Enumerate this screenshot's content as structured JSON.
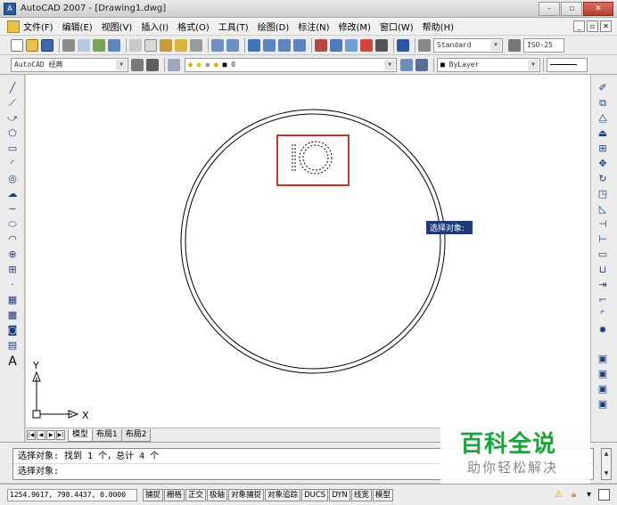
{
  "window": {
    "title": "AutoCAD 2007 - [Drawing1.dwg]",
    "app_icon_text": "A",
    "minimize": "–",
    "maximize": "▫",
    "close": "✕"
  },
  "menu": {
    "items": [
      "文件(F)",
      "编辑(E)",
      "视图(V)",
      "插入(I)",
      "格式(O)",
      "工具(T)",
      "绘图(D)",
      "标注(N)",
      "修改(M)",
      "窗口(W)",
      "帮助(H)"
    ],
    "mdi": [
      "_",
      "▫",
      "✕"
    ]
  },
  "toolbar": {
    "text_style": "Standard",
    "dim_style": "ISO-25",
    "workspace": "AutoCAD 经典",
    "layer": "0",
    "color": "ByLayer"
  },
  "canvas": {
    "tooltip": "选择对象:",
    "ucs_x": "X",
    "ucs_y": "Y",
    "highlight_color": "#c0392b"
  },
  "layout_tabs": {
    "nav": [
      "|◀",
      "◀",
      "▶",
      "▶|"
    ],
    "tabs": [
      "模型",
      "布局1",
      "布局2"
    ]
  },
  "command": {
    "line1": "选择对象: 找到 1 个，总计 4 个",
    "line2": "选择对象:"
  },
  "watermark": {
    "title": "百科全说",
    "subtitle": "助你轻松解决"
  },
  "status": {
    "coords": "1254.9617, 798.4437, 0.0000",
    "buttons": [
      "捕捉",
      "栅格",
      "正交",
      "极轴",
      "对象捕捉",
      "对象追踪",
      "DUCS",
      "DYN",
      "线宽",
      "模型"
    ]
  }
}
